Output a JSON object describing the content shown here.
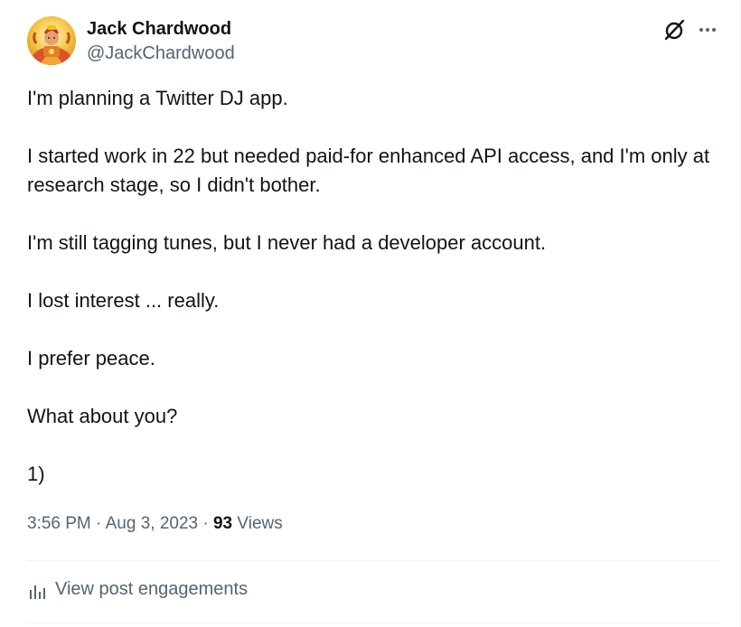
{
  "author": {
    "name": "Jack Chardwood",
    "handle": "@JackChardwood",
    "avatar_icon": "avatar-image"
  },
  "actions": {
    "grok_icon": "grok-icon",
    "more_icon": "more-icon"
  },
  "tweet": {
    "paragraphs": [
      "I'm planning a Twitter DJ app.",
      "I started work in 22 but needed paid-for enhanced API access, and I'm only at research stage, so I didn't bother.",
      "I'm still tagging tunes, but I never had a developer account.",
      "I lost interest ... really.",
      "I prefer peace.",
      "What about you?",
      "1)"
    ]
  },
  "meta": {
    "time": "3:56 PM",
    "separator": "·",
    "date": "Aug 3, 2023",
    "views_count": "93",
    "views_label": "Views"
  },
  "engagements": {
    "icon": "analytics-icon",
    "label": "View post engagements"
  },
  "colors": {
    "text": "#0f1419",
    "secondary": "#536471",
    "divider": "#eff3f4"
  }
}
